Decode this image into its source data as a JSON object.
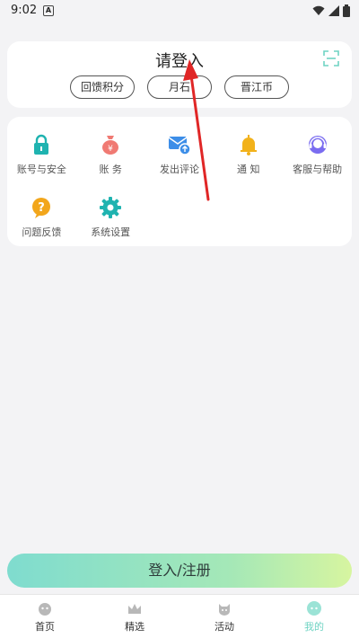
{
  "status_bar": {
    "time": "9:02",
    "notification_glyph": "A",
    "icons": [
      "wifi-icon",
      "signal-icon",
      "battery-icon"
    ]
  },
  "account_card": {
    "title": "请登入",
    "pills": [
      "回馈积分",
      "月石",
      "晋江币"
    ]
  },
  "menu": {
    "items": [
      {
        "label": "账号与安全",
        "icon": "lock-icon",
        "color": "#1fb3b0"
      },
      {
        "label": "账 务",
        "icon": "money-bag-icon",
        "color": "#f07a73"
      },
      {
        "label": "发出评论",
        "icon": "mail-upload-icon",
        "color": "#3d8ee8"
      },
      {
        "label": "通 知",
        "icon": "bell-icon",
        "color": "#f2b21b"
      },
      {
        "label": "客服与帮助",
        "icon": "customer-service-icon",
        "color": "#7a6cf0"
      },
      {
        "label": "问题反馈",
        "icon": "question-icon",
        "color": "#f2a61b"
      },
      {
        "label": "系统设置",
        "icon": "gear-icon",
        "color": "#1fb3b0"
      }
    ]
  },
  "login_button": "登入/注册",
  "tabs": [
    {
      "label": "首页",
      "icon": "home-icon",
      "active": false
    },
    {
      "label": "精选",
      "icon": "crown-icon",
      "active": false
    },
    {
      "label": "活动",
      "icon": "activity-icon",
      "active": false
    },
    {
      "label": "我的",
      "icon": "profile-icon",
      "active": true
    }
  ],
  "colors": {
    "accent": "#6fd3c3",
    "background": "#f3f3f5",
    "annotation_arrow": "#e02626"
  }
}
